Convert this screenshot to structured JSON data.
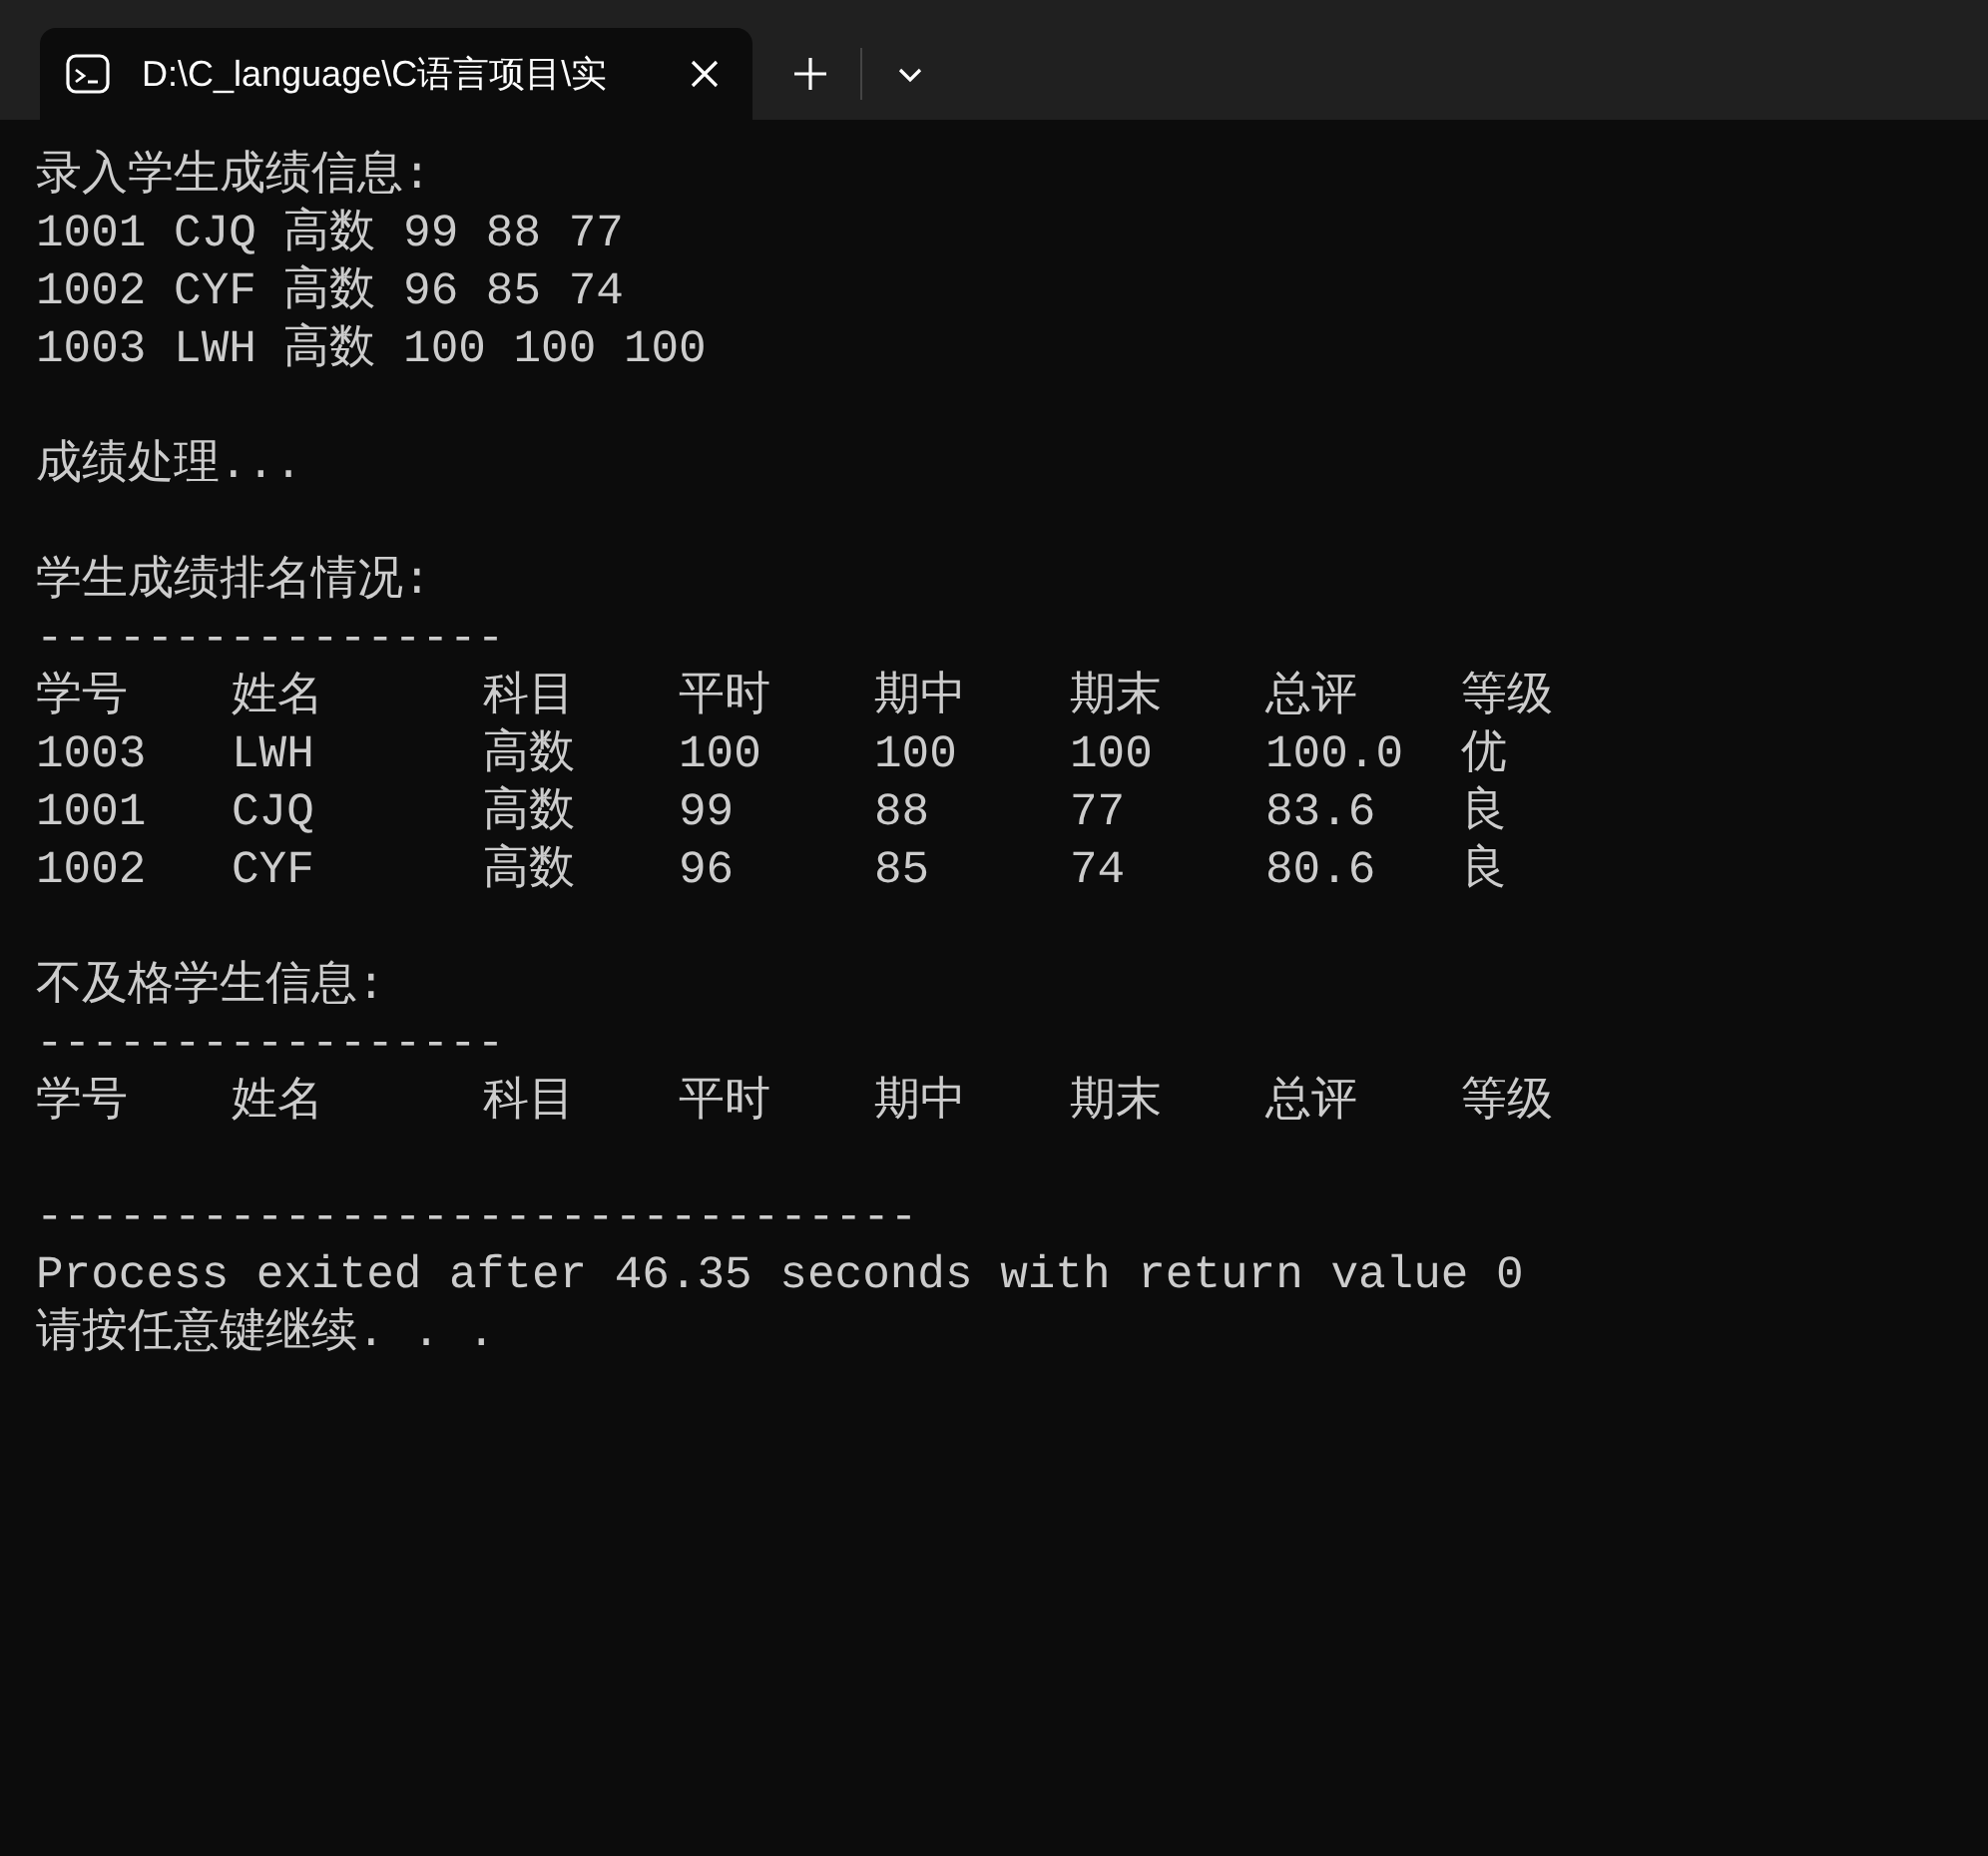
{
  "window": {
    "tabs": [
      {
        "title": "D:\\C_language\\C语言项目\\实",
        "selected": true
      }
    ]
  },
  "console": [
    {
      "kind": "text",
      "text": "录入学生成绩信息:"
    },
    {
      "kind": "text",
      "text": "1001 CJQ 高数 99 88 77"
    },
    {
      "kind": "text",
      "text": "1002 CYF 高数 96 85 74"
    },
    {
      "kind": "text",
      "text": "1003 LWH 高数 100 100 100"
    },
    {
      "kind": "blank"
    },
    {
      "kind": "text",
      "text": "成绩处理..."
    },
    {
      "kind": "blank"
    },
    {
      "kind": "text",
      "text": "学生成绩排名情况:"
    },
    {
      "kind": "rule",
      "text": "-----------------"
    },
    {
      "kind": "table",
      "columns": [
        "学号",
        "姓名",
        "科目",
        "平时",
        "期中",
        "期末",
        "总评",
        "等级"
      ],
      "rows": [
        [
          "1003",
          "LWH",
          "高数",
          "100",
          "100",
          "100",
          "100.0",
          "优"
        ],
        [
          "1001",
          "CJQ",
          "高数",
          "99",
          "88",
          "77",
          "83.6",
          "良"
        ],
        [
          "1002",
          "CYF",
          "高数",
          "96",
          "85",
          "74",
          "80.6",
          "良"
        ]
      ]
    },
    {
      "kind": "blank"
    },
    {
      "kind": "text",
      "text": "不及格学生信息:"
    },
    {
      "kind": "rule",
      "text": "-----------------"
    },
    {
      "kind": "table",
      "columns": [
        "学号",
        "姓名",
        "科目",
        "平时",
        "期中",
        "期末",
        "总评",
        "等级"
      ]
    },
    {
      "kind": "blank"
    },
    {
      "kind": "rule",
      "text": "--------------------------------"
    },
    {
      "kind": "text",
      "text": "Process exited after 46.35 seconds with return value 0"
    },
    {
      "kind": "text",
      "text": "请按任意键继续. . ."
    }
  ]
}
